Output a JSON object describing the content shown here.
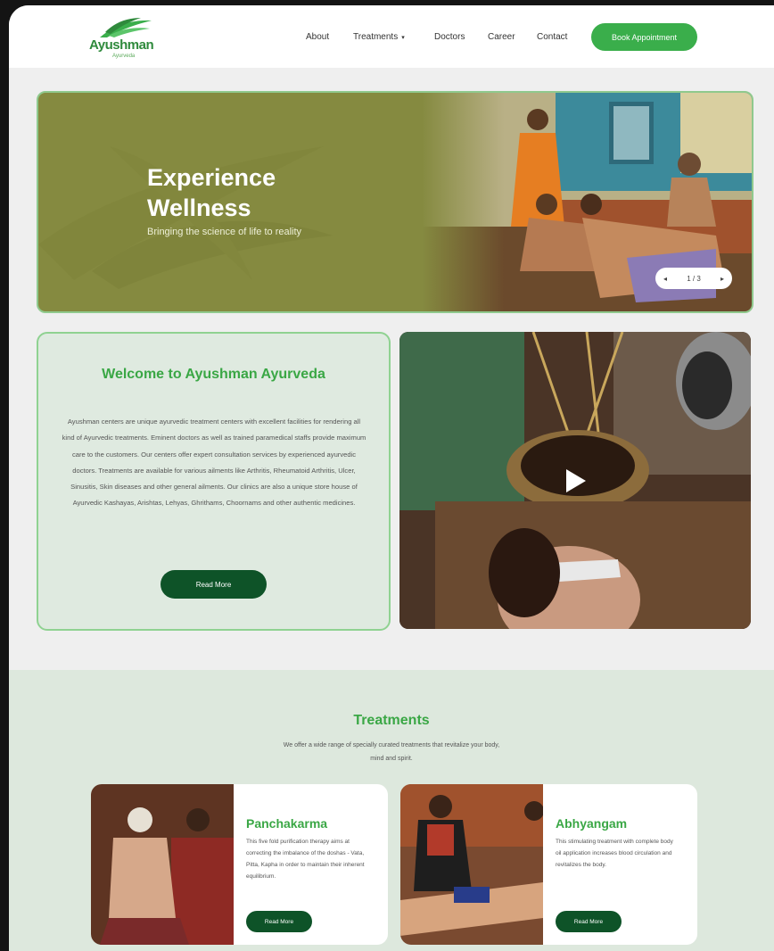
{
  "brand": {
    "name": "Ayushman",
    "tagline": "Ayurveda",
    "color": "#3aae4b",
    "dark_color": "#0e5328"
  },
  "nav": {
    "items": [
      "About",
      "Treatments",
      "Doctors",
      "Career",
      "Contact"
    ],
    "treatments_caret": "▾",
    "book_label": "Book Appointment"
  },
  "hero": {
    "title": "Experience Wellness",
    "subtitle": "Bringing the science of life to reality",
    "slider": {
      "prev": "◂",
      "counter": "1 / 3",
      "next": "▸"
    }
  },
  "welcome": {
    "title": "Welcome to Ayushman Ayurveda",
    "body": "Ayushman centers are unique ayurvedic treatment centers with excellent facilities for rendering all kind of Ayurvedic treatments. Eminent doctors as well as trained paramedical staffs provide maximum care to the customers. Our centers offer expert consultation services by experienced ayurvedic doctors. Treatments are available for various ailments like Arthritis, Rheumatoid Arthritis, Ulcer, Sinusitis, Skin diseases and other general ailments. Our clinics are also a unique store house of Ayurvedic Kashayas, Arishtas, Lehyas, Ghrithams, Choornams and other authentic medicines.",
    "read_more": "Read More"
  },
  "video": {
    "play_icon": "play-icon"
  },
  "treatments": {
    "title": "Treatments",
    "subtitle": "We offer a wide range of specially curated treatments that revitalize your body, mind and spirit.",
    "cards": [
      {
        "title": "Panchakarma",
        "description": "This five fold purification therapy aims at correcting the imbalance of the doshas - Vata, Pitta, Kapha in order to maintain their inherent equilibrium.",
        "button": "Read More"
      },
      {
        "title": "Abhyangam",
        "description": "This stimulating treatment with complete body oil application increases blood circulation and revitalizes the body.",
        "button": "Read More"
      }
    ]
  }
}
